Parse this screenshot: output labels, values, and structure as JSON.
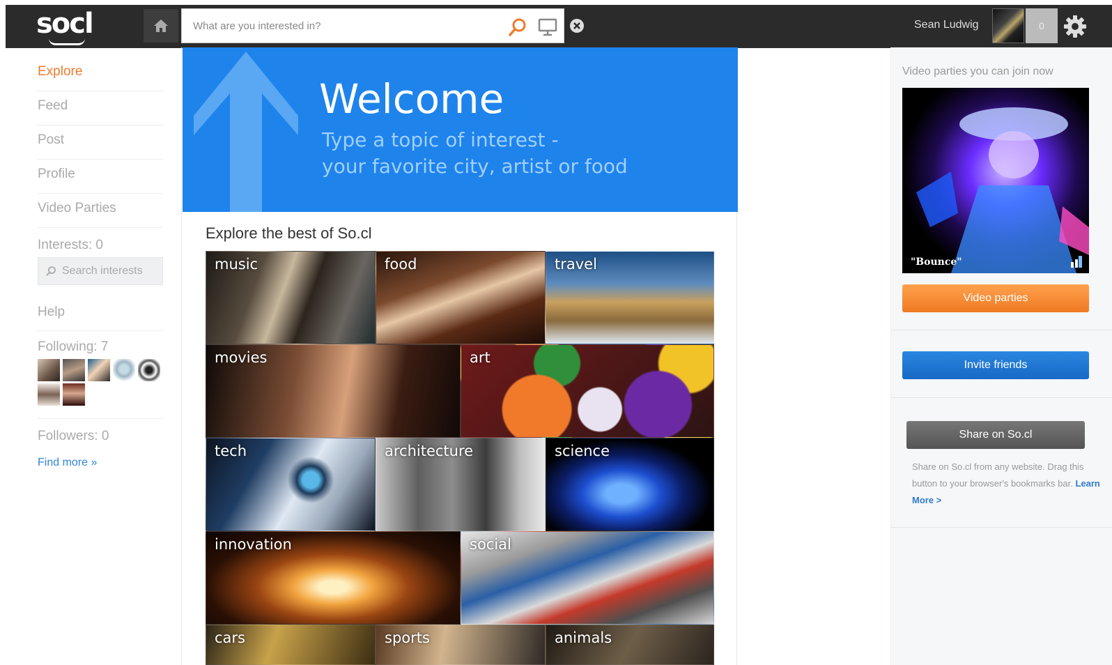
{
  "topbar": {
    "logo": "socl",
    "search_placeholder": "What are you interested in?",
    "user_name": "Sean Ludwig",
    "notification_count": "0",
    "icons": [
      "home-icon",
      "search-icon",
      "monitor-icon",
      "close-circle-icon",
      "gear-icon"
    ]
  },
  "leftnav": {
    "items": [
      {
        "label": "Explore",
        "active": true
      },
      {
        "label": "Feed"
      },
      {
        "label": "Post"
      },
      {
        "label": "Profile"
      },
      {
        "label": "Video Parties"
      }
    ],
    "interests_label": "Interests: 0",
    "search_interests_placeholder": "Search interests",
    "help_label": "Help",
    "following_label": "Following: 7",
    "followers_label": "Followers: 0",
    "find_more_label": "Find more »"
  },
  "welcome": {
    "title": "Welcome",
    "subtitle_line1": "Type a topic of interest -",
    "subtitle_line2": "your favorite city, artist or food"
  },
  "explore": {
    "heading": "Explore the best of So.cl",
    "tiles": [
      "music",
      "food",
      "travel",
      "movies",
      "art",
      "tech",
      "architecture",
      "science",
      "innovation",
      "social",
      "cars",
      "sports",
      "animals"
    ]
  },
  "rightcol": {
    "vp_heading": "Video parties you can join now",
    "video_caption": "\"Bounce\"",
    "video_parties_button": "Video parties",
    "invite_button": "Invite friends",
    "share_button": "Share on So.cl",
    "share_text": "Share on So.cl from any website. Drag this button to your browser's bookmarks bar.",
    "learn_more": "Learn More >"
  },
  "colors": {
    "topbar_bg": "#2b2b2b",
    "welcome_blue": "#1f83ec",
    "accent_orange": "#f07a2a",
    "link_blue": "#2f86d8"
  }
}
